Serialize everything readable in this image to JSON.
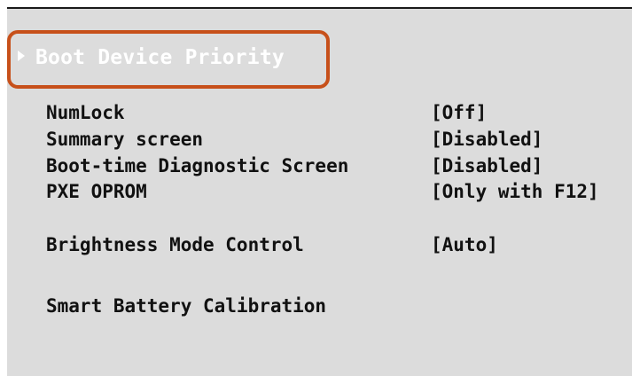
{
  "menu": {
    "selected_item": {
      "label": "Boot Device Priority",
      "icon": "right-triangle-icon"
    },
    "items": [
      {
        "label": "NumLock",
        "value": "[Off]"
      },
      {
        "label": "Summary screen",
        "value": "[Disabled]"
      },
      {
        "label": "Boot-time Diagnostic Screen",
        "value": "[Disabled]"
      },
      {
        "label": "PXE OPROM",
        "value": "[Only with F12]"
      },
      {
        "label": "Brightness Mode Control",
        "value": "[Auto]"
      },
      {
        "label": "Smart Battery Calibration",
        "value": ""
      }
    ]
  },
  "colors": {
    "background": "#dcdcdc",
    "text": "#111111",
    "selected_text": "#ffffff",
    "highlight_border": "#c7501a"
  }
}
